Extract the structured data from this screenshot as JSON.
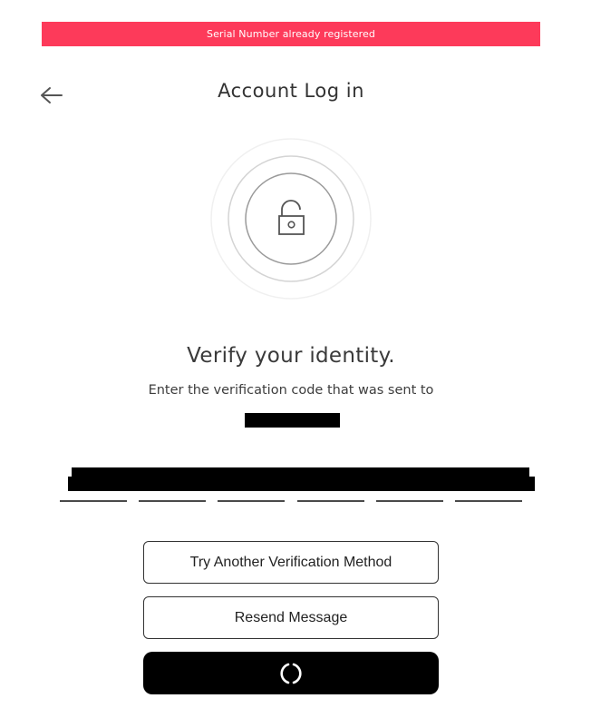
{
  "banner": {
    "message": "Serial Number already registered",
    "color": "#fd3a5a"
  },
  "header": {
    "back_icon": "arrow-left-icon",
    "title": "Account Log in"
  },
  "hero": {
    "icon": "unlocked-padlock-icon"
  },
  "verify": {
    "heading": "Verify your identity.",
    "instruction": "Enter the verification code that was sent to",
    "destination_redacted": true
  },
  "code_input": {
    "digit_count": 6
  },
  "actions": {
    "try_another_label": "Try Another Verification Method",
    "resend_label": "Resend Message",
    "submit_state": "loading",
    "submit_icon": "loading-spinner-icon"
  }
}
